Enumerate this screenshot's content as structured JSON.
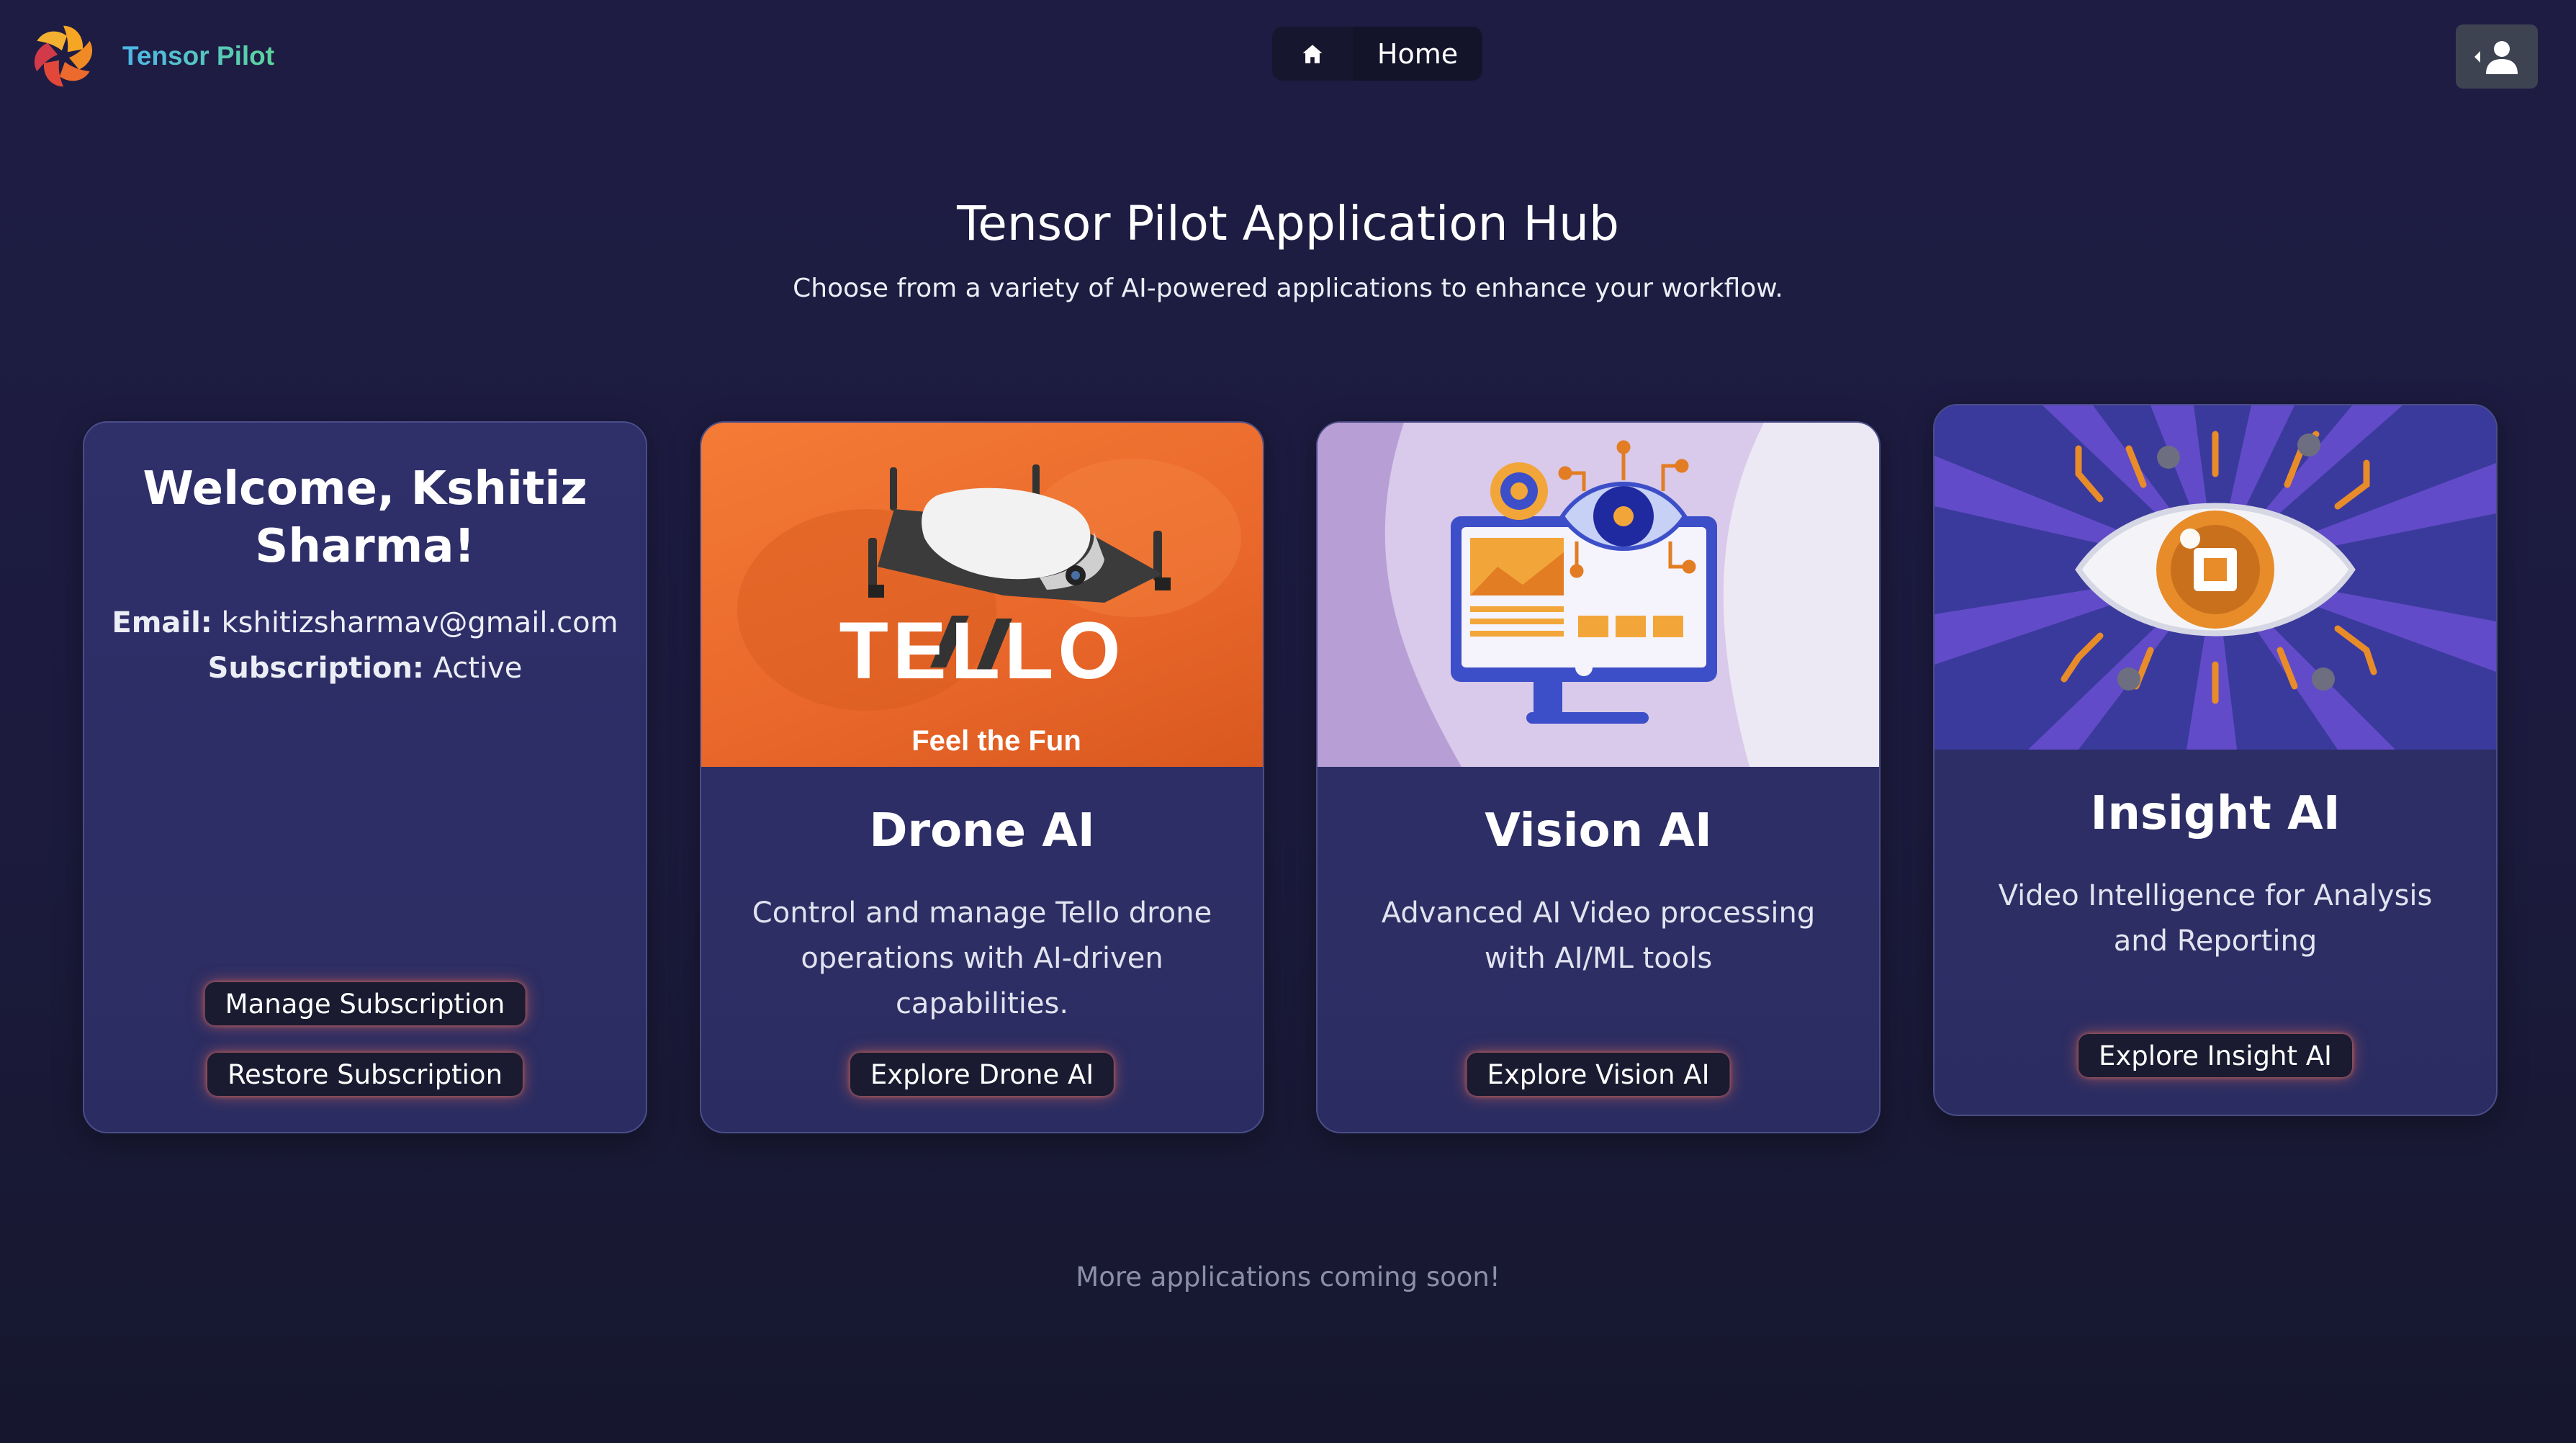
{
  "app": {
    "name": "Tensor Pilot"
  },
  "nav": {
    "home_label": "Home"
  },
  "hero": {
    "title": "Tensor Pilot Application Hub",
    "subtitle": "Choose from a variety of AI-powered applications to enhance your workflow."
  },
  "welcome": {
    "title": "Welcome, Kshitiz Sharma!",
    "email_label": "Email:",
    "email": "kshitizsharmav@gmail.com",
    "subscription_label": "Subscription:",
    "subscription_status": "Active",
    "manage_label": "Manage Subscription",
    "restore_label": "Restore Subscription"
  },
  "apps": [
    {
      "title": "Drone AI",
      "description": "Control and manage Tello drone operations with AI-driven capabilities.",
      "button": "Explore Drone AI",
      "image_brand": "TELLO",
      "image_tagline": "Feel the Fun"
    },
    {
      "title": "Vision AI",
      "description": "Advanced AI Video processing with AI/ML tools",
      "button": "Explore Vision AI"
    },
    {
      "title": "Insight AI",
      "description": "Video Intelligence for Analysis and Reporting",
      "button": "Explore Insight AI"
    }
  ],
  "footer": {
    "note": "More applications coming soon!"
  },
  "icons": {
    "logo": "tensor-pilot-logo",
    "home": "home-icon",
    "profile": "user-profile-icon"
  },
  "colors": {
    "accent_glow": "#ff6e50",
    "card_bg": "#2f2f6a",
    "drone_orange": "#ee6a2c",
    "insight_purple": "#3d3aa3"
  }
}
